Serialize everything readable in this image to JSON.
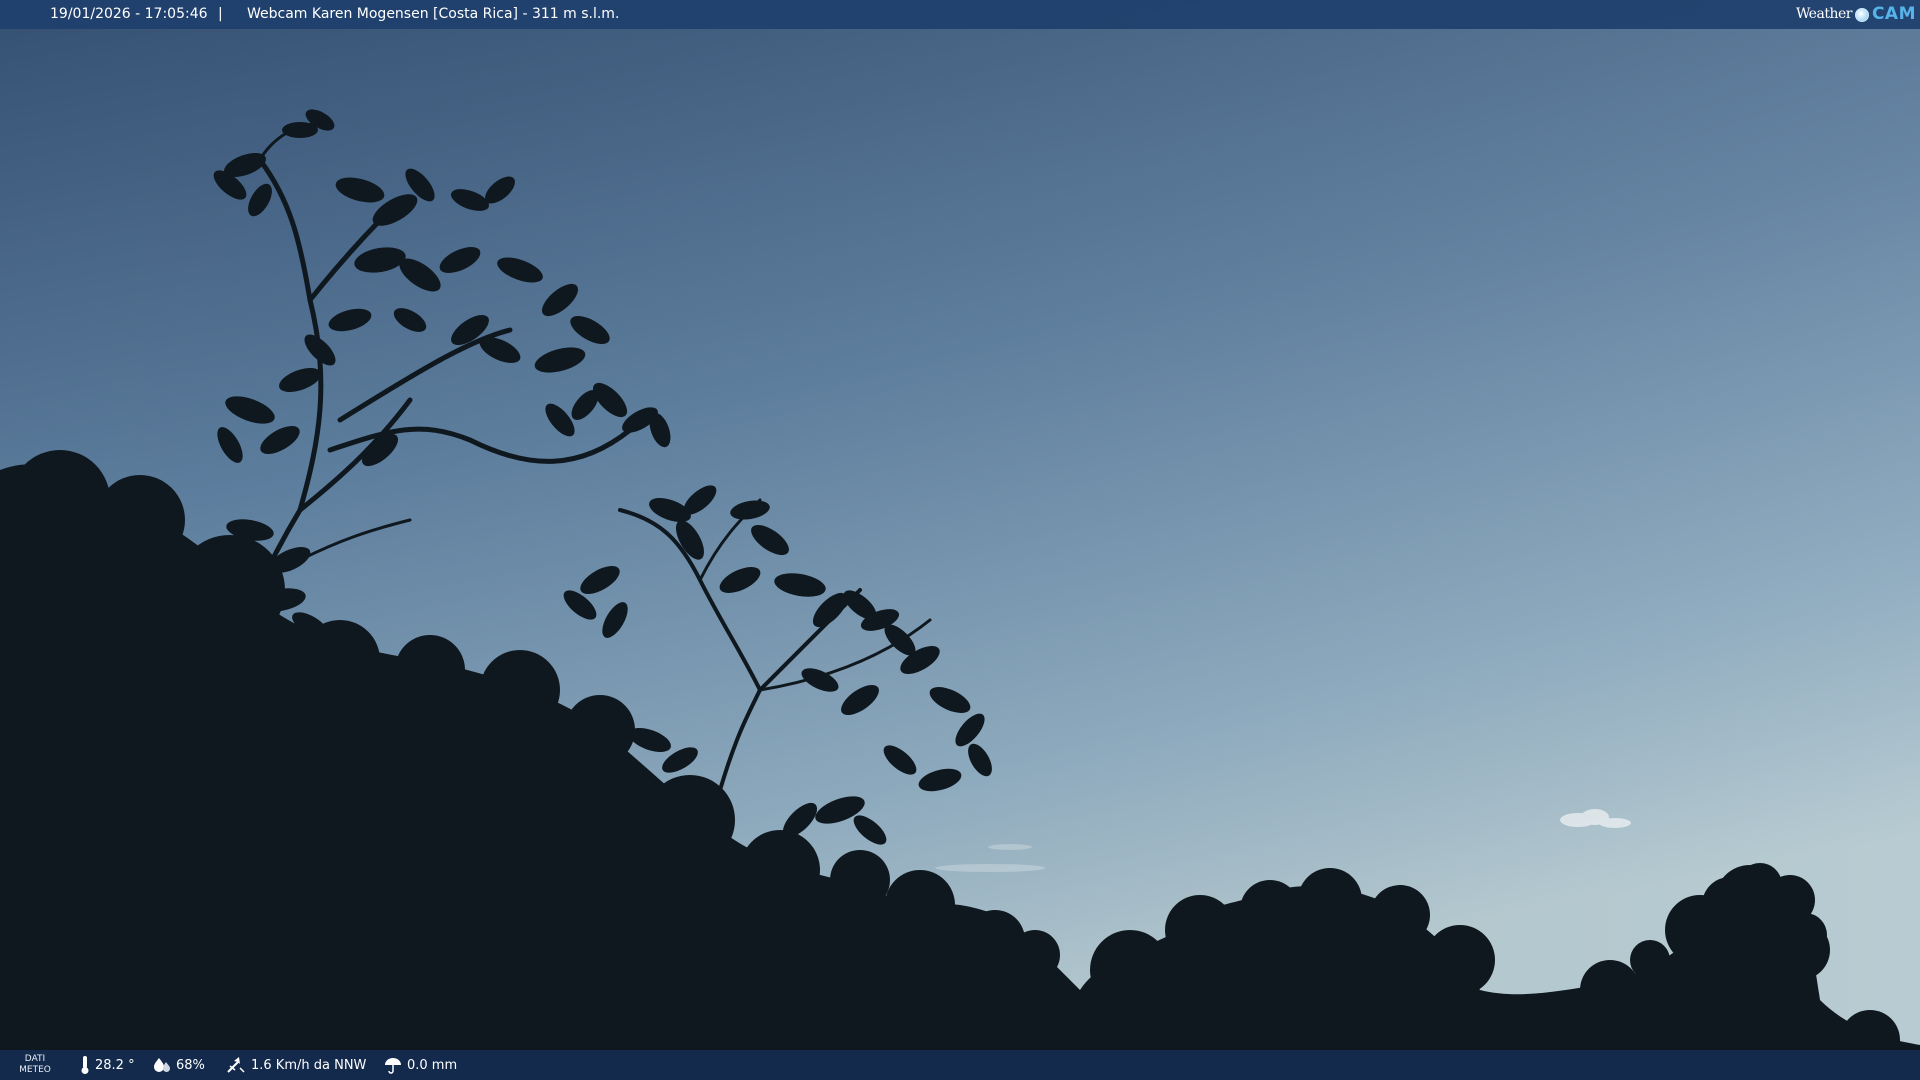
{
  "overlay": {
    "timestamp": "19/01/2026 - 17:05:46",
    "separator": "|",
    "title": "Webcam Karen Mogensen [Costa Rica]  - 311 m s.l.m.",
    "logo": {
      "weather": "Weather",
      "cam": "CAM"
    }
  },
  "weather_data": {
    "label_line1": "DATI",
    "label_line2": "METEO",
    "temperature": "28.2 °",
    "humidity": "68%",
    "wind": "1.6 Km/h da NNW",
    "rain": "0.0 mm"
  },
  "colors": {
    "sky_top": "#3d5a7d",
    "sky_bottom": "#a9c2cf",
    "silhouette": "#101a21",
    "bar_top": "#1e3f6c",
    "bar_bottom": "#142c50",
    "logo_accent": "#57b4ea"
  }
}
